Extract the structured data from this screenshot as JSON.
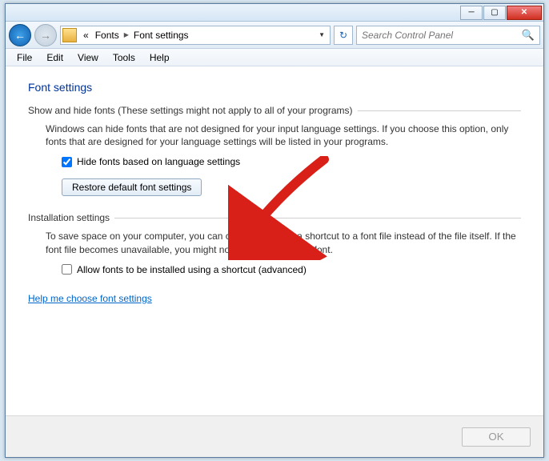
{
  "breadcrumb": {
    "prefix": "«",
    "item1": "Fonts",
    "item2": "Font settings"
  },
  "search": {
    "placeholder": "Search Control Panel"
  },
  "menu": {
    "file": "File",
    "edit": "Edit",
    "view": "View",
    "tools": "Tools",
    "help": "Help"
  },
  "page": {
    "heading": "Font settings",
    "group1_label": "Show and hide fonts (These settings might not apply to all of your programs)",
    "group1_desc": "Windows can hide fonts that are not designed for your input language settings. If you choose this option, only fonts that are designed for your language settings will be listed in your programs.",
    "hide_fonts_cb_label": "Hide fonts based on language settings",
    "hide_fonts_checked": true,
    "restore_btn": "Restore default font settings",
    "group2_label": "Installation settings",
    "group2_desc": "To save space on your computer, you can choose to install a shortcut to a font file instead of the file itself. If the font file becomes unavailable, you might not be able to use the font.",
    "shortcut_cb_label": "Allow fonts to be installed using a shortcut (advanced)",
    "shortcut_checked": false,
    "help_link": "Help me choose font settings",
    "ok_btn": "OK"
  }
}
